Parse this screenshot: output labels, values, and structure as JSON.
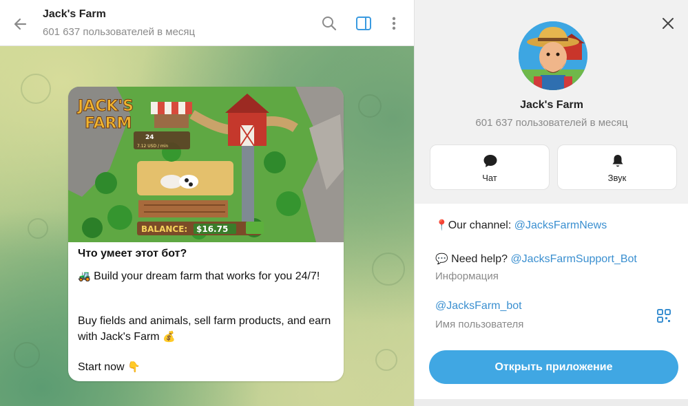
{
  "chat": {
    "title": "Jack's Farm",
    "subtitle": "601 637 пользователей в месяц",
    "header_icons": [
      "arrow-left-icon",
      "search-icon",
      "sidebar-toggle-icon",
      "more-vertical-icon"
    ],
    "message": {
      "image_texts": {
        "logo_line1": "JACK'S",
        "logo_line2": "FARM",
        "counter": "24",
        "rate": "7.12 USD / min",
        "balance_label": "BALANCE:",
        "balance_value": "$16.75"
      },
      "title": "Что умеет этот бот?",
      "line1_emoji": "🚜",
      "line1": "Build your dream farm that works for you 24/7!",
      "line2": "Buy fields and animals, sell farm products, and earn with Jack's Farm",
      "line2_emoji": "💰",
      "line3": "Start now",
      "line3_emoji": "👇"
    }
  },
  "info": {
    "name": "Jack's Farm",
    "subtitle": "601 637 пользователей в месяц",
    "actions": [
      {
        "label": "Чат",
        "icon": "chat-bubble-icon"
      },
      {
        "label": "Звук",
        "icon": "bell-icon"
      }
    ],
    "channel": {
      "emoji": "📍",
      "label": "Our channel: ",
      "link": "@JacksFarmNews"
    },
    "help": {
      "emoji": "💬",
      "label": "Need help? ",
      "link": "@JacksFarmSupport_Bot"
    },
    "help_caption": "Информация",
    "username": "@JacksFarm_bot",
    "username_caption": "Имя пользователя",
    "open_button": "Открыть приложение"
  },
  "colors": {
    "accent": "#40a7e3",
    "link": "#3a8fd0",
    "muted_text": "#8a8a8a"
  }
}
